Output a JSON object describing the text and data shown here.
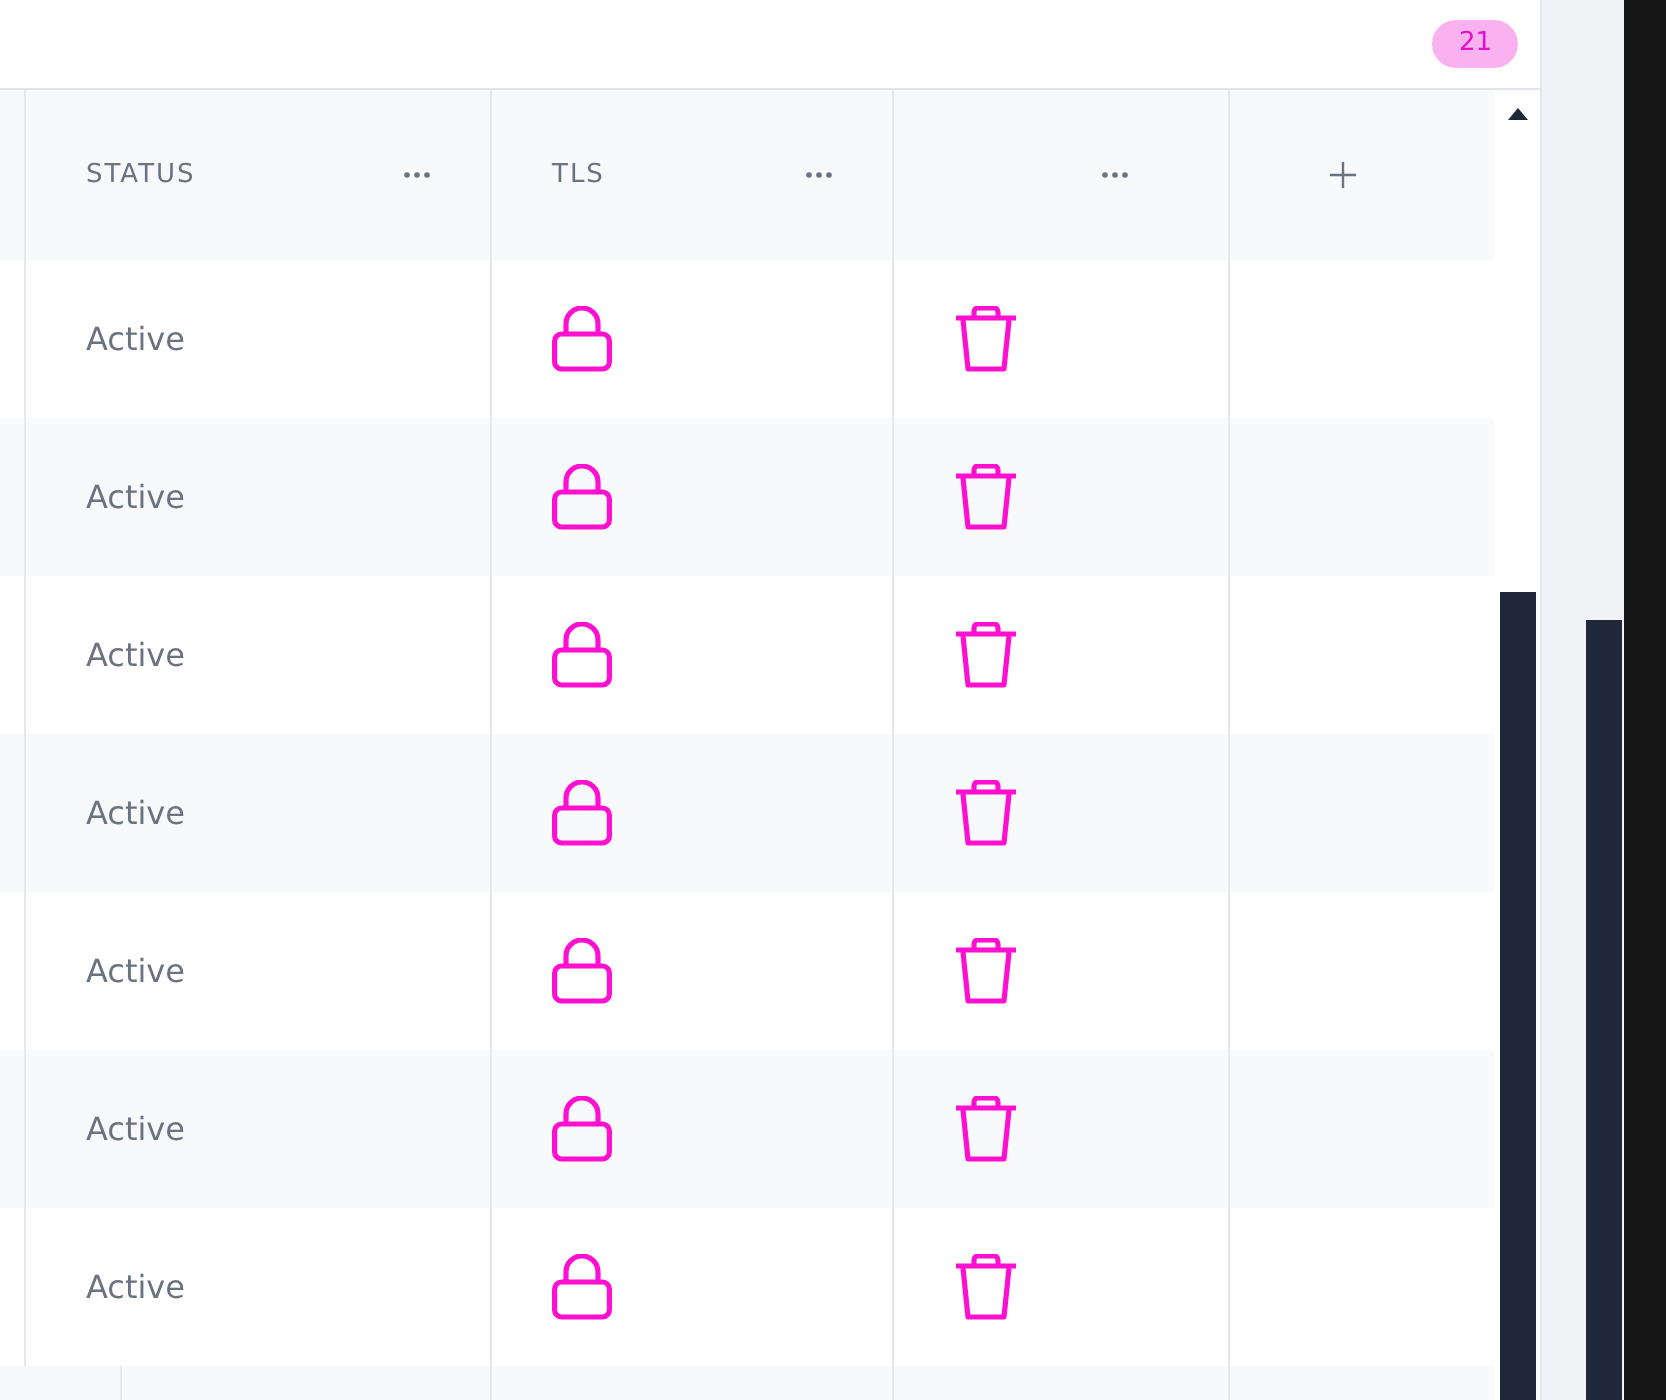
{
  "top_bar": {
    "badge": "21"
  },
  "table": {
    "columns": [
      {
        "kind": "text",
        "label": "STATUS"
      },
      {
        "kind": "lock",
        "label": "TLS"
      },
      {
        "kind": "delete"
      },
      {
        "kind": "add"
      }
    ],
    "rows": [
      {
        "status": "Active",
        "tls": true
      },
      {
        "status": "Active",
        "tls": true
      },
      {
        "status": "Active",
        "tls": true
      },
      {
        "status": "Active",
        "tls": true
      },
      {
        "status": "Active",
        "tls": true
      },
      {
        "status": "Active",
        "tls": true
      },
      {
        "status": "Active",
        "tls": true
      }
    ]
  }
}
